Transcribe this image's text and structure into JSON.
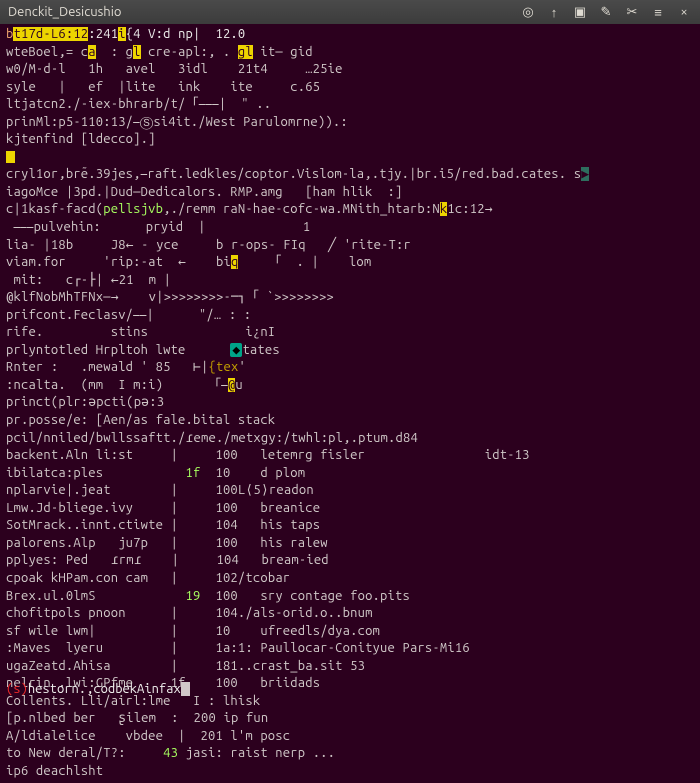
{
  "titlebar": {
    "title": "Denckit_Desicushio"
  },
  "term": {
    "l1a": "b",
    "l1b": "t17d-L6:12",
    "l1c": ":241",
    "l1d": "i",
    "l1e": "{4 V:d np|  12.0",
    "l2a": "wteBoel,= c",
    "l2b": "a",
    "l2c": "  : g",
    "l2d": "l",
    "l2e": " cre-apl:, . ",
    "l2f": "gl",
    "l2g": " it— gid",
    "l3": "w0/M-d-l   1h   avel   3idl    21t4     …25ie",
    "l4": "syle   |   ef  |lite   ink    ite     c.65",
    "l5": "ltjatcn2./-iex-bhrarb/t/「⎯⎯⎯|  \" ..",
    "l6": "prinMl:p5-110:13/⎯Ⓢsi4it./West Parulomrne)).:",
    "l7": "kjtenfind [ldecco].]",
    "l8": "",
    "l9a": "cryl1or,brẽ.39jes,⎯raft.ledkles/coptor.Vislom-la,.tjy.|br.i5/red.bad.cates. s",
    "l9b": "▶",
    "l10": "iagoMce |3pd.|Dud—Dedicalors. RMP.amg   [ham hlik  :]",
    "l11a": "c|1kasf-facd(",
    "l11b": "pellsjvb",
    "l11c": ",./remm raN-hae-cofc-wa.MNith_htarb:N",
    "l11d": "k",
    "l11e": "1c:12→",
    "l12": " ⎯⎯⎯pulvehin:      pryid  |             1",
    "l13": "lia- |18b     J8← - yce     b r-ops- FIq   ╱ 'rite-T:r",
    "l14a": "viam.for     'rip:-at  ←    bi",
    "l14b": "q",
    "l14c": "    「  . |    lom",
    "l15": " mit:   c┌-├| ←21  m |",
    "l16": "@klfNobMhTFNx—→    v|>>>>>>>>-─┐「 `>>>>>>>>",
    "l17": "prifcont.Feclasv/⎯⎯|      \"/… : :",
    "l18": "rife.         stins             i¿nI",
    "l19a": "prlyntotled Hrpltoh lwte      ",
    "l19b": "◆",
    "l19c": "tates",
    "l20a": "Rnter :   .mewald ' 85   ⊢|",
    "l20b": "{tex",
    "l20c": "'",
    "l21a": ":ncalta.  (mm  I m:i)      「⎯",
    "l21b": "@",
    "l21c": "u",
    "l22": "princt(plr:əpcti(pə:3",
    "l23": "pr.posse/e: [Aen/as fale.bital stack",
    "l24": "pcil/nniled/bwllssaftt./ɾeme./metxgy:/twhl:pl,.ptum.d84",
    "rows": [
      [
        "backent.Aln li:st",
        "|",
        "",
        "100",
        "letemrg fisler",
        "idt-13"
      ],
      [
        "ibilatca:ples",
        "",
        "1f",
        "10",
        "d plom",
        ""
      ],
      [
        "nplarvie|.jeat",
        "|",
        "",
        "100L⟨5⟩",
        "readon",
        ""
      ],
      [
        "Lmw.Jd-bliege.ivy",
        "|",
        "",
        "100",
        "breanice",
        ""
      ],
      [
        "SotMrack..innt.ctiwte",
        "|",
        "",
        "104",
        "his taps",
        ""
      ],
      [
        "palorens.Alp   ju7p",
        "|",
        "",
        "100",
        "his ralew",
        ""
      ],
      [
        "pplyes: Ped   ɾrmɾ",
        "|",
        "",
        "104",
        "bream-ied",
        ""
      ],
      [
        "cpoak kHPam.con cam",
        "|",
        "",
        "102/tc",
        "obar",
        ""
      ],
      [
        "Brex.ul.0lmS",
        "",
        "19",
        "100",
        "sry contage foo.pits",
        ""
      ],
      [
        "chofitpols pnoon",
        "|",
        "",
        "104./als-orid.o..bnum",
        "",
        ""
      ],
      [
        "sf wile lwm|",
        "|",
        "",
        "10",
        "ufreedls/dya.com",
        ""
      ],
      [
        ":Maves  lyeru",
        "|",
        "",
        "1a:1:",
        "Paullocar-Conityue Pars-Mi16",
        ""
      ],
      [
        "ugaZeatd.Ahisa",
        "|",
        "",
        "181..crast_ba.sit 53",
        "",
        ""
      ],
      [
        "nelrin .lwi:GPfme",
        "1f",
        "",
        "100",
        "briidads",
        ""
      ]
    ],
    "l39": "Collents. Lli/airl:lme   I : lhisk",
    "l40": "[p.nlbed ber   ʂilem  :  200 ip fun",
    "l41": "A/ldialelice    vbdee  |  201 l'm posc",
    "l42a": "to New deral/T?:     ",
    "l42b": "43",
    "l42c": " jasi: raist nerp ...",
    "l43": "ip6 deachlsht",
    "status_left": "(s)",
    "status_text": "hestorn.,codbekAinfax"
  }
}
